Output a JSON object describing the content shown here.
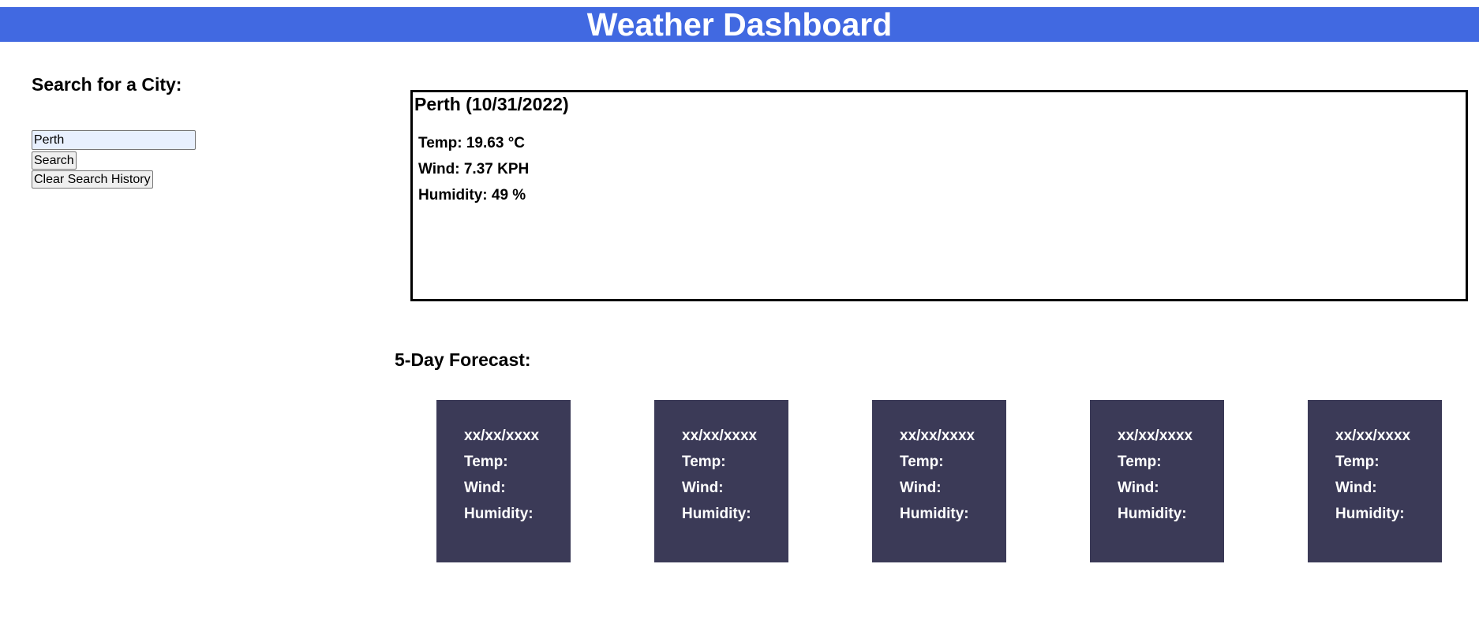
{
  "header": {
    "title": "Weather Dashboard"
  },
  "search": {
    "heading": "Search for a City:",
    "input_value": "Perth",
    "search_label": "Search",
    "clear_label": "Clear Search History"
  },
  "current": {
    "title": "Perth (10/31/2022)",
    "temp": "Temp: 19.63 °C",
    "wind": "Wind: 7.37 KPH",
    "humidity": "Humidity: 49 %"
  },
  "forecast": {
    "heading": "5-Day Forecast:",
    "cards": [
      {
        "date": "xx/xx/xxxx",
        "temp": "Temp:",
        "wind": "Wind:",
        "humidity": "Humidity:"
      },
      {
        "date": "xx/xx/xxxx",
        "temp": "Temp:",
        "wind": "Wind:",
        "humidity": "Humidity:"
      },
      {
        "date": "xx/xx/xxxx",
        "temp": "Temp:",
        "wind": "Wind:",
        "humidity": "Humidity:"
      },
      {
        "date": "xx/xx/xxxx",
        "temp": "Temp:",
        "wind": "Wind:",
        "humidity": "Humidity:"
      },
      {
        "date": "xx/xx/xxxx",
        "temp": "Temp:",
        "wind": "Wind:",
        "humidity": "Humidity:"
      }
    ]
  },
  "colors": {
    "header_bg": "#4169e1",
    "card_bg": "#3b3a57",
    "input_bg": "#e8f0fe"
  }
}
